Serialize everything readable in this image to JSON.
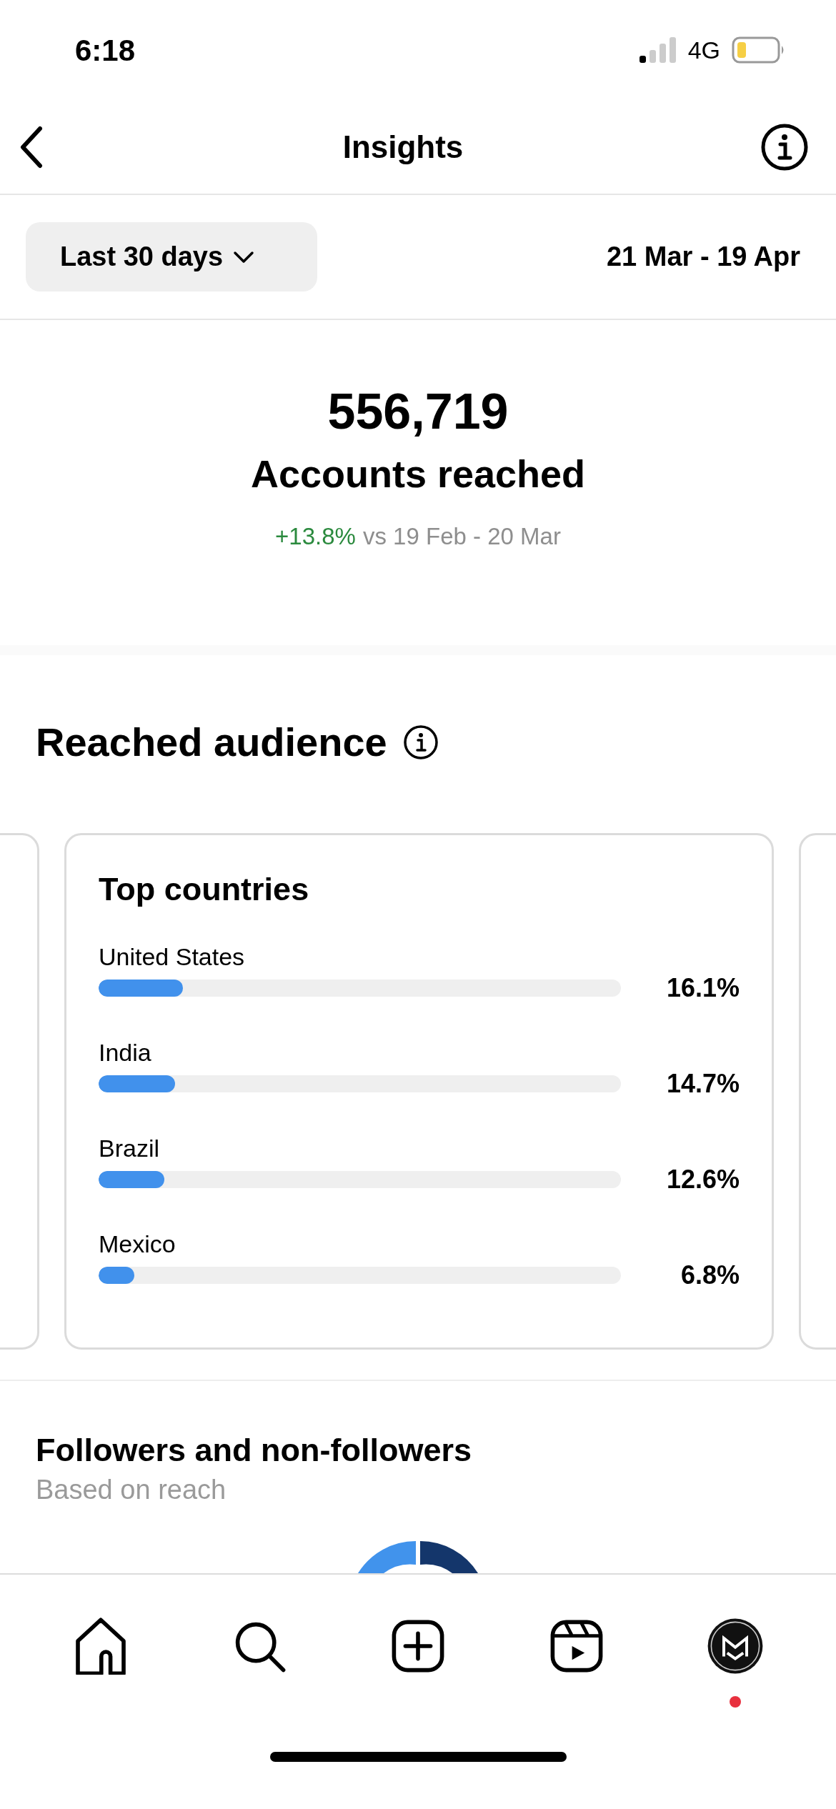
{
  "status_bar": {
    "time": "6:18",
    "network": "4G"
  },
  "header": {
    "title": "Insights"
  },
  "filter": {
    "period": "Last 30 days",
    "date_range": "21 Mar - 19 Apr"
  },
  "summary": {
    "value": "556,719",
    "label": "Accounts reached",
    "change": "+13.8%",
    "comparison": "vs 19 Feb - 20 Mar"
  },
  "reached_audience": {
    "title": "Reached audience",
    "card": {
      "title": "Top countries",
      "rows": [
        {
          "name": "United States",
          "level": 0.161,
          "percent": "16.1%"
        },
        {
          "name": "India",
          "level": 0.147,
          "percent": "14.7%"
        },
        {
          "name": "Brazil",
          "level": 0.126,
          "percent": "12.6%"
        },
        {
          "name": "Mexico",
          "level": 0.068,
          "percent": "6.8%"
        }
      ]
    }
  },
  "followers_section": {
    "title": "Followers and non-followers",
    "subtitle": "Based on reach"
  },
  "tab_bar": [
    {
      "kind": "home",
      "notification": false
    },
    {
      "kind": "search",
      "notification": false
    },
    {
      "kind": "create",
      "notification": false
    },
    {
      "kind": "reels",
      "notification": false
    },
    {
      "kind": "profile",
      "notification": true
    }
  ]
}
